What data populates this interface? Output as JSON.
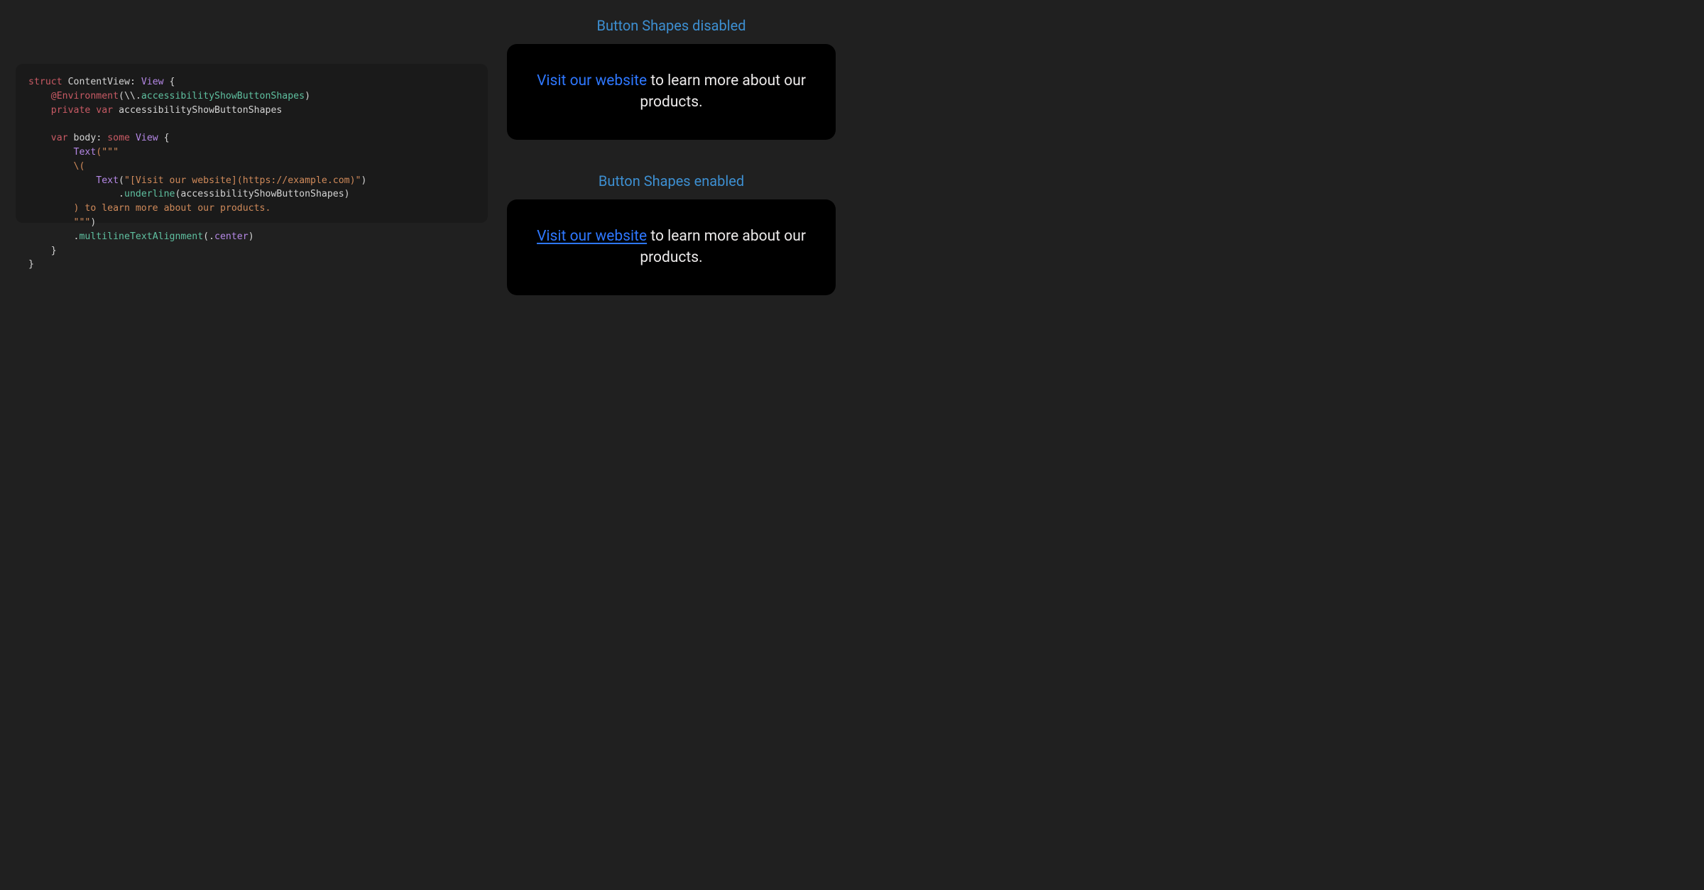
{
  "code": {
    "struct_kw": "struct",
    "struct_name": "ContentView",
    "colon": ":",
    "view_type": "View",
    "open_brace": " {",
    "env_decorator": "@Environment",
    "env_open": "(\\\\.",
    "env_symbol": "accessibilityShowButtonShapes",
    "env_close": ")",
    "private_kw": "private",
    "var_kw": "var",
    "env_var_name": "accessibilityShowButtonShapes",
    "body_var_kw": "var",
    "body_name": "body",
    "body_colon": ":",
    "some_kw": "some",
    "body_type": "View",
    "body_open": " {",
    "text_type": "Text",
    "triple_open": "(\"\"\"",
    "interp_open": "\\(",
    "inner_text_type": "Text",
    "inner_open": "(",
    "inner_literal": "\"[Visit our website](https://example.com)\"",
    "inner_close": ")",
    "underline_dot": ".",
    "underline_method": "underline",
    "underline_open": "(",
    "underline_arg": "accessibilityShowButtonShapes",
    "underline_close": ")",
    "interp_close_rest": ") to learn more about our products.",
    "triple_close": "\"\"\"",
    "triple_close_paren": ")",
    "mta_dot": ".",
    "mta_method": "multilineTextAlignment",
    "mta_open": "(.",
    "mta_case": "center",
    "mta_close": ")",
    "body_close": "}",
    "struct_close": "}"
  },
  "preview": {
    "disabled_title": "Button Shapes disabled",
    "enabled_title": "Button Shapes enabled",
    "link_text": "Visit our website",
    "rest_text": " to learn more about our products."
  }
}
